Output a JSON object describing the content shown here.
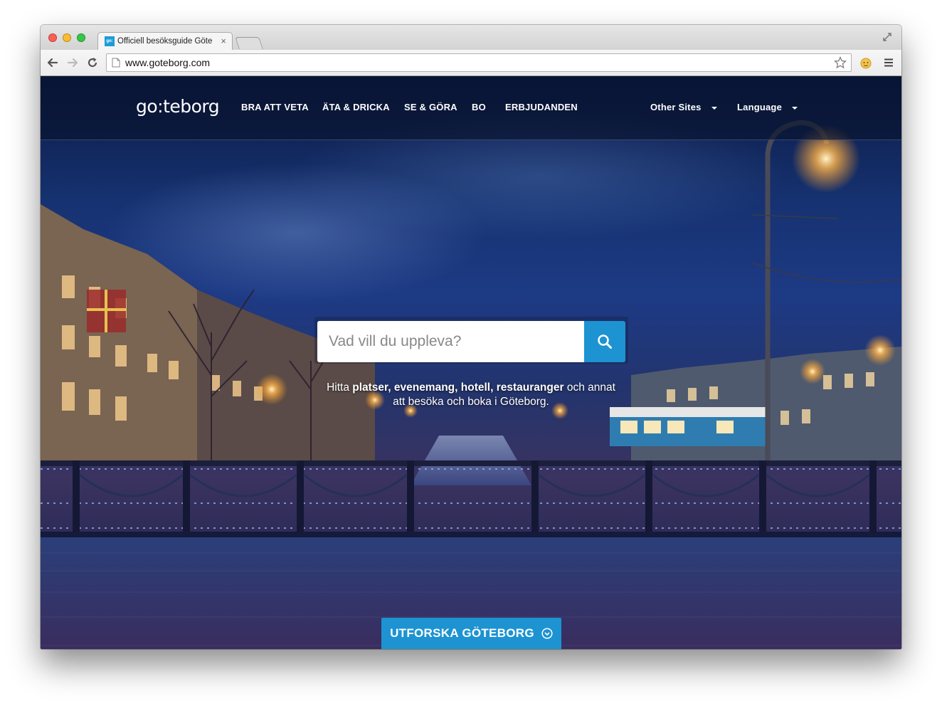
{
  "browser": {
    "tab": {
      "favicon_text": "go:",
      "title": "Officiell besöksguide Göte",
      "close_glyph": "×"
    },
    "toolbar": {
      "url": "www.goteborg.com"
    }
  },
  "site": {
    "logo": "go:teborg",
    "nav": {
      "items": [
        "BRA ATT VETA",
        "ÄTA & DRICKA",
        "SE & GÖRA",
        "BO",
        "ERBJUDANDEN"
      ],
      "other_sites": "Other Sites",
      "language": "Language"
    },
    "search": {
      "placeholder": "Vad vill du uppleva?"
    },
    "tagline": {
      "prefix": "Hitta ",
      "bold1": "platser",
      "sep1": ", ",
      "bold2": "evenemang",
      "sep2": ", ",
      "bold3": "hotell",
      "sep3": ", ",
      "bold4": "restauranger",
      "suffix": " och annat att besöka och boka i Göteborg."
    },
    "cta": "UTFORSKA GÖTEBORG"
  },
  "colors": {
    "accent": "#1d93d2"
  },
  "icons": [
    "back-icon",
    "forward-icon",
    "reload-icon",
    "page-icon",
    "star-icon",
    "extension-icon",
    "menu-icon",
    "search-icon",
    "chevron-down-circle-icon"
  ]
}
